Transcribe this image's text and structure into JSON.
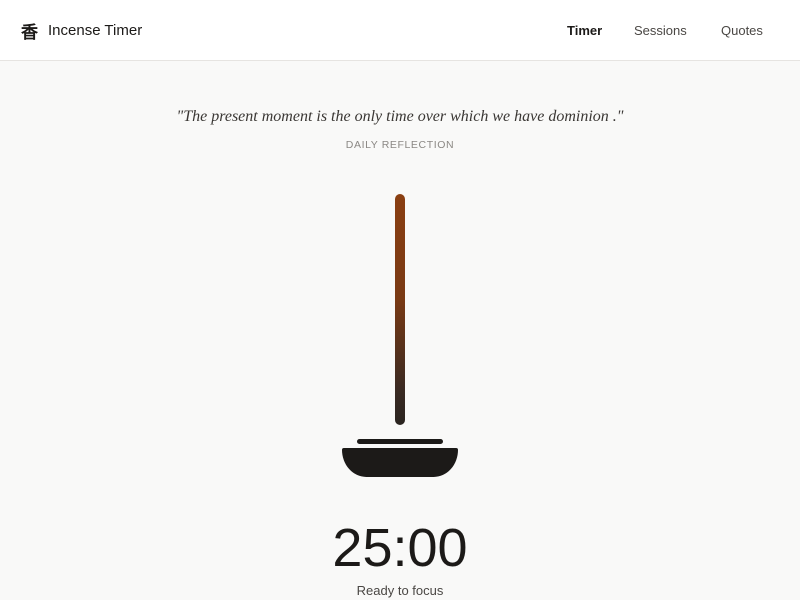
{
  "app": {
    "icon_glyph": "香",
    "icon_name": "incense-kanji-icon",
    "title": "Incense Timer"
  },
  "nav": {
    "items": [
      {
        "label": "Timer",
        "active": true
      },
      {
        "label": "Sessions",
        "active": false
      },
      {
        "label": "Quotes",
        "active": false
      }
    ]
  },
  "quote": {
    "text": "\"The present moment  is the only time over which we have dominion .\"",
    "label": "DAILY REFLECTION"
  },
  "timer": {
    "display": "25:00",
    "status": "Ready to focus",
    "remaining_fraction": 1.0
  },
  "colors": {
    "background": "#f9f9f8",
    "stick_top": "#8a3f12",
    "stick_bottom": "#2a2420",
    "holder": "#1c1a18"
  }
}
